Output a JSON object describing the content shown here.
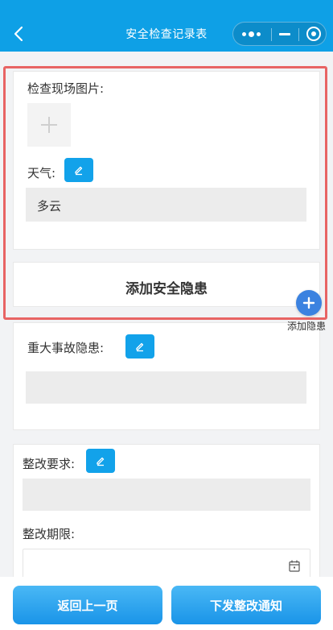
{
  "header": {
    "title": "安全检查记录表"
  },
  "section1": {
    "photo_label": "检查现场图片:",
    "weather_label": "天气:",
    "weather_value": "多云"
  },
  "add_hazard": {
    "label": "添加安全隐患",
    "fab_label": "添加隐患"
  },
  "section2": {
    "major_hazard_label": "重大事故隐患:",
    "major_hazard_value": ""
  },
  "section3": {
    "requirement_label": "整改要求:",
    "requirement_value": "",
    "deadline_label": "整改期限:",
    "deadline_value": ""
  },
  "footer": {
    "back_label": "返回上一页",
    "issue_label": "下发整改通知"
  },
  "colors": {
    "header": "#0ea0e6",
    "edit_button": "#12a2ea",
    "fab": "#3b82e0",
    "highlight_frame": "#e86464"
  },
  "icons": [
    "back-icon",
    "more-icon",
    "minimize-icon",
    "close-icon",
    "plus-icon",
    "edit-icon",
    "calendar-icon"
  ]
}
